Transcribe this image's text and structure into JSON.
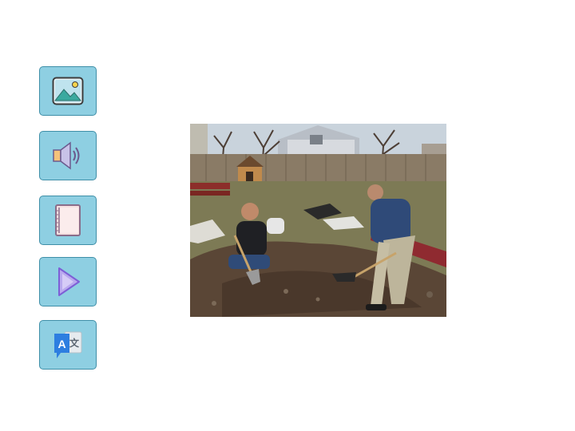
{
  "toolbar": {
    "buttons": [
      {
        "id": "image",
        "icon": "image-icon"
      },
      {
        "id": "audio",
        "icon": "speaker-icon"
      },
      {
        "id": "book",
        "icon": "book-icon"
      },
      {
        "id": "play",
        "icon": "play-icon"
      },
      {
        "id": "translate",
        "icon": "translate-icon",
        "glyph_latin": "A",
        "glyph_cjk": "文"
      }
    ]
  },
  "photo": {
    "colors": {
      "sky": "#c9d3dc",
      "grass": "#7d7a55",
      "dirt": "#5a4636",
      "fence": "#8a7b66"
    }
  }
}
